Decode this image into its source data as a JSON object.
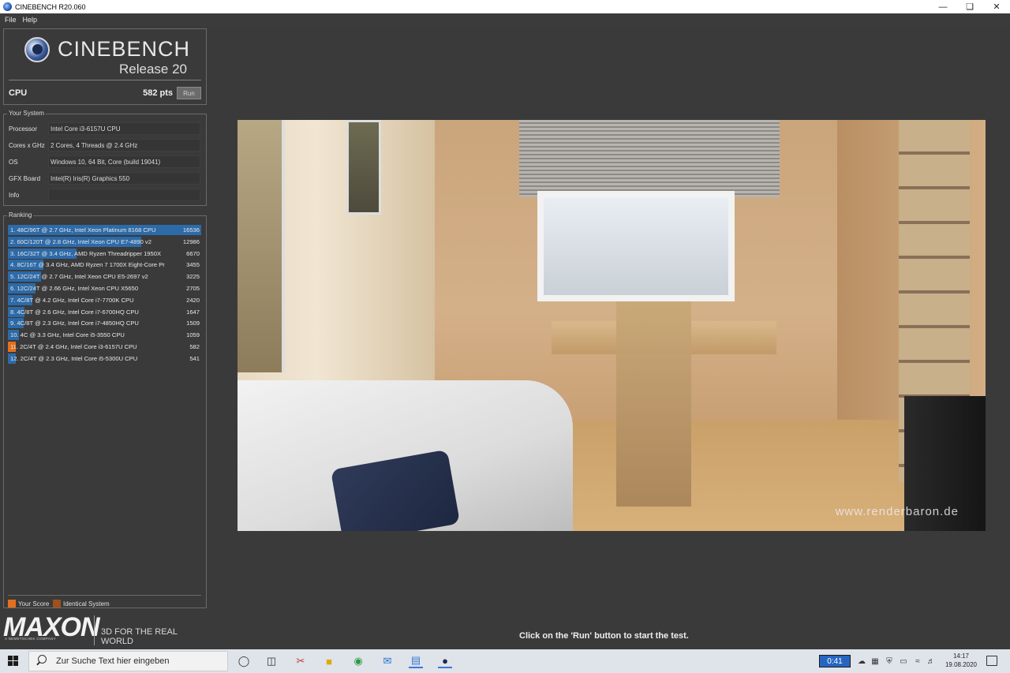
{
  "window": {
    "title": "CINEBENCH R20.060"
  },
  "menu": {
    "file": "File",
    "help": "Help"
  },
  "logo": {
    "name": "CINEBENCH",
    "release": "Release 20"
  },
  "cpu": {
    "label": "CPU",
    "score": "582 pts",
    "run_label": "Run"
  },
  "system": {
    "group_label": "Your System",
    "rows": [
      {
        "key": "Processor",
        "value": "Intel Core i3-6157U CPU"
      },
      {
        "key": "Cores x GHz",
        "value": "2 Cores, 4 Threads @ 2.4 GHz"
      },
      {
        "key": "OS",
        "value": "Windows 10, 64 Bit, Core (build 19041)"
      },
      {
        "key": "GFX Board",
        "value": "Intel(R) Iris(R) Graphics 550"
      },
      {
        "key": "Info",
        "value": ""
      }
    ]
  },
  "ranking": {
    "group_label": "Ranking",
    "max_score": 16536,
    "items": [
      {
        "label": "1. 48C/96T @ 2.7 GHz, Intel Xeon Platinum 8168 CPU",
        "score": "16536",
        "value": 16536,
        "selected": true,
        "mine": false
      },
      {
        "label": "2. 60C/120T @ 2.8 GHz, Intel Xeon CPU E7-4890 v2",
        "score": "12986",
        "value": 12986,
        "selected": false,
        "mine": false
      },
      {
        "label": "3. 16C/32T @ 3.4 GHz, AMD Ryzen Threadripper 1950X",
        "score": "6670",
        "value": 6670,
        "selected": false,
        "mine": false
      },
      {
        "label": "4. 8C/16T @ 3.4 GHz, AMD Ryzen 7 1700X Eight-Core Pr",
        "score": "3455",
        "value": 3455,
        "selected": false,
        "mine": false
      },
      {
        "label": "5. 12C/24T @ 2.7 GHz, Intel Xeon CPU E5-2697 v2",
        "score": "3225",
        "value": 3225,
        "selected": false,
        "mine": false
      },
      {
        "label": "6. 12C/24T @ 2.66 GHz, Intel Xeon CPU X5650",
        "score": "2705",
        "value": 2705,
        "selected": false,
        "mine": false
      },
      {
        "label": "7. 4C/8T @ 4.2 GHz, Intel Core i7-7700K CPU",
        "score": "2420",
        "value": 2420,
        "selected": false,
        "mine": false
      },
      {
        "label": "8. 4C/8T @ 2.6 GHz, Intel Core i7-6700HQ CPU",
        "score": "1647",
        "value": 1647,
        "selected": false,
        "mine": false
      },
      {
        "label": "9. 4C/8T @ 2.3 GHz, Intel Core i7-4850HQ CPU",
        "score": "1509",
        "value": 1509,
        "selected": false,
        "mine": false
      },
      {
        "label": "10. 4C @ 3.3 GHz, Intel Core i5-3550 CPU",
        "score": "1059",
        "value": 1059,
        "selected": false,
        "mine": false
      },
      {
        "label": "11. 2C/4T @ 2.4 GHz, Intel Core i3-6157U CPU",
        "score": "582",
        "value": 582,
        "selected": false,
        "mine": true
      },
      {
        "label": "12. 2C/4T @ 2.3 GHz, Intel Core i5-5300U CPU",
        "score": "541",
        "value": 541,
        "selected": false,
        "mine": false
      }
    ],
    "legend": {
      "your_score": "Your Score",
      "identical": "Identical System"
    }
  },
  "maxon": {
    "logo": "MAXON",
    "subtitle": "A NEMETSCHEK COMPANY",
    "tagline": "3D FOR THE REAL WORLD"
  },
  "render": {
    "watermark": "www.renderbaron.de"
  },
  "hint": "Click on the 'Run' button to start the test.",
  "taskbar": {
    "search_placeholder": "Zur Suche Text hier eingeben",
    "timer": "0:41",
    "time": "14:17",
    "date": "19.08.2020"
  },
  "colors": {
    "bar_blue": "#2d6aa8",
    "selected_row": "#2f7bc3",
    "your_score": "#e2701c",
    "identical": "#a0501c"
  }
}
